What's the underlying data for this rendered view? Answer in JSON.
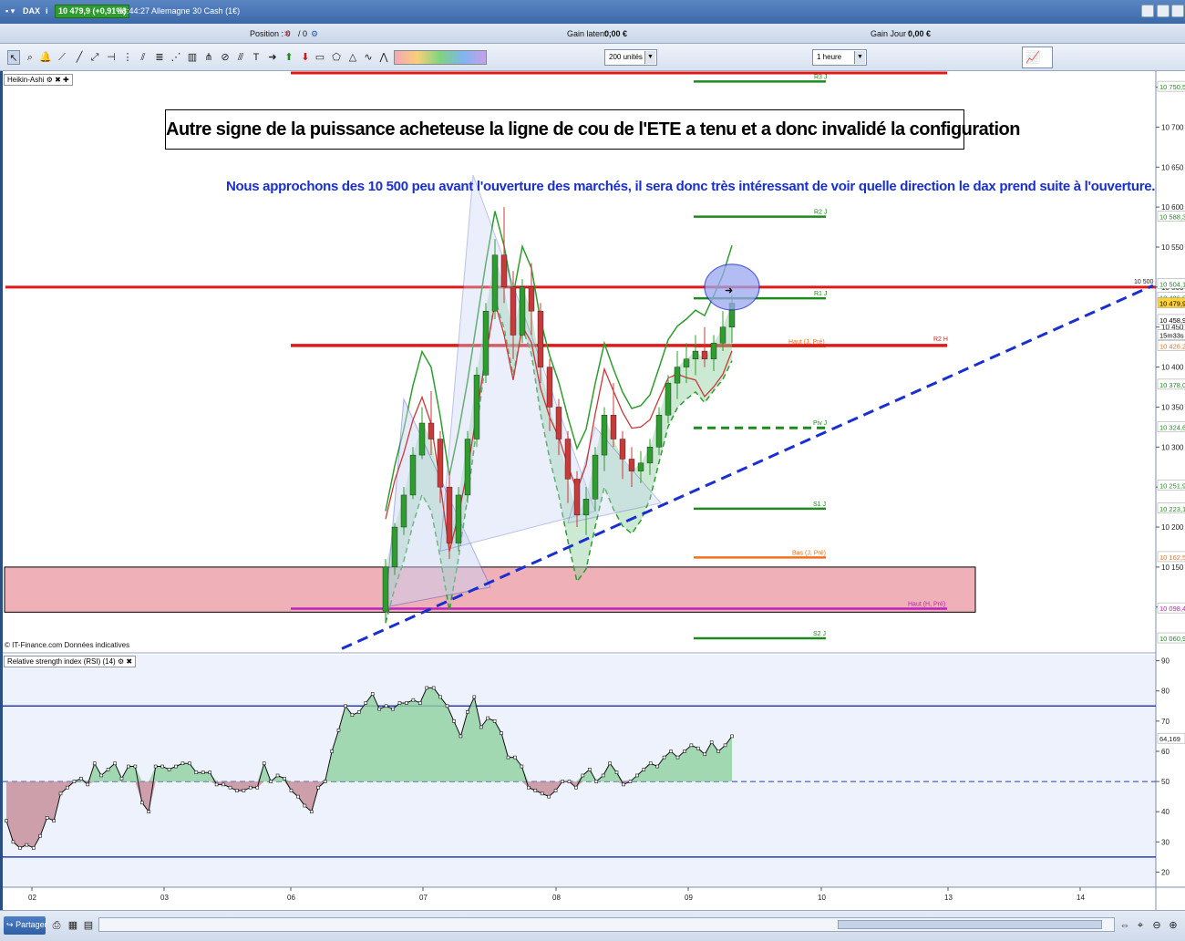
{
  "window": {
    "symbol": "DAX",
    "info_glyph": "i",
    "price_badge": "10 479,9 (+0,91%)",
    "time_name": "08:44:27 Allemagne 30 Cash (1€)"
  },
  "position_bar": {
    "position": "Position : 0",
    "position_mid": "/ 0",
    "gain_latent": "Gain latent :",
    "gain_latent_value": "0,00 €",
    "gain_jour": "Gain Jour :",
    "gain_jour_value": "0,00 €"
  },
  "toolbar": {
    "units_value": "200 unités",
    "timeframe_value": "1 heure"
  },
  "panes": {
    "price_label": "Heikin-Ashi",
    "rsi_label": "Relative strength index (RSI) (14)"
  },
  "annotations": {
    "boxed_title": "Autre signe de la puissance acheteuse la ligne de cou de l'ETE a tenu et a donc invalidé la configuration",
    "blue_text": "Nous approchons des 10 500 peu avant l'ouverture des marchés, il sera donc très intéressant de voir quelle direction le dax prend suite à l'ouverture."
  },
  "credit": "© IT-Finance.com Données indicatives",
  "bottom_bar": {
    "share_label": "Partager"
  },
  "colors": {
    "bull": "#2e9c2e",
    "bear": "#c83a3a",
    "resistance": "#e01818",
    "trendline": "#1a2fd0",
    "pivot_green": "#1e8a1e",
    "orange": "#f07020",
    "magenta": "#c020c0",
    "zone_fill": "#f0b0b8",
    "rsi_line": "#2a3fb0"
  },
  "chart_data": [
    {
      "type": "candlestick",
      "style": "Heikin-Ashi",
      "ylim": [
        10045,
        10770
      ],
      "y_ticks": [
        10100,
        10150,
        10200,
        10250,
        10300,
        10350,
        10400,
        10450,
        10500,
        10550,
        10600,
        10650,
        10700,
        10750
      ],
      "x_tick_labels": [
        "02",
        "03",
        "06",
        "07",
        "08",
        "09",
        "10",
        "13",
        "14"
      ],
      "price_labels": [
        "10 750,5",
        "10 588,3",
        "10 504,1",
        "10 486,8",
        "10 479,9",
        "10 458,9",
        "15m33s",
        "10 426,2",
        "10 378,0",
        "10 324,6",
        "10 251,9",
        "10 223,1",
        "10 162,5",
        "10 098,4",
        "10 060,9"
      ],
      "levels": [
        {
          "name": "R3 J",
          "value": 10757
        },
        {
          "name": "R2 J",
          "value": 10588
        },
        {
          "name": "R1 J",
          "value": 10486
        },
        {
          "name": "Haut (J, Pré)",
          "value": 10426
        },
        {
          "name": "R2 H",
          "value": 10427
        },
        {
          "name": "Piv J",
          "value": 10324
        },
        {
          "name": "S1 J",
          "value": 10223
        },
        {
          "name": "Bas (J, Pré)",
          "value": 10162
        },
        {
          "name": "Haut (H, Pré)",
          "value": 10098
        },
        {
          "name": "S2 J",
          "value": 10061
        }
      ],
      "resistance_label": "10 500",
      "candles_ohlc": [
        [
          10095,
          10160,
          10080,
          10150
        ],
        [
          10150,
          10205,
          10140,
          10200
        ],
        [
          10200,
          10250,
          10190,
          10240
        ],
        [
          10240,
          10300,
          10235,
          10290
        ],
        [
          10290,
          10350,
          10285,
          10330
        ],
        [
          10330,
          10370,
          10290,
          10310
        ],
        [
          10310,
          10320,
          10230,
          10250
        ],
        [
          10250,
          10270,
          10160,
          10180
        ],
        [
          10180,
          10250,
          10170,
          10240
        ],
        [
          10240,
          10320,
          10230,
          10310
        ],
        [
          10310,
          10400,
          10300,
          10390
        ],
        [
          10390,
          10480,
          10380,
          10470
        ],
        [
          10470,
          10560,
          10460,
          10540
        ],
        [
          10540,
          10600,
          10480,
          10500
        ],
        [
          10500,
          10520,
          10410,
          10440
        ],
        [
          10440,
          10510,
          10430,
          10500
        ],
        [
          10500,
          10530,
          10440,
          10470
        ],
        [
          10470,
          10480,
          10380,
          10400
        ],
        [
          10400,
          10410,
          10320,
          10350
        ],
        [
          10350,
          10360,
          10290,
          10310
        ],
        [
          10310,
          10320,
          10230,
          10260
        ],
        [
          10260,
          10270,
          10200,
          10215
        ],
        [
          10215,
          10250,
          10190,
          10235
        ],
        [
          10235,
          10300,
          10220,
          10290
        ],
        [
          10290,
          10350,
          10270,
          10340
        ],
        [
          10340,
          10380,
          10300,
          10310
        ],
        [
          10310,
          10320,
          10260,
          10285
        ],
        [
          10285,
          10300,
          10250,
          10270
        ],
        [
          10270,
          10295,
          10255,
          10280
        ],
        [
          10280,
          10310,
          10265,
          10300
        ],
        [
          10300,
          10350,
          10290,
          10340
        ],
        [
          10340,
          10390,
          10330,
          10380
        ],
        [
          10380,
          10420,
          10360,
          10400
        ],
        [
          10400,
          10430,
          10380,
          10410
        ],
        [
          10410,
          10440,
          10390,
          10420
        ],
        [
          10420,
          10450,
          10400,
          10410
        ],
        [
          10410,
          10440,
          10395,
          10430
        ],
        [
          10430,
          10470,
          10420,
          10450
        ],
        [
          10450,
          10490,
          10430,
          10480
        ]
      ]
    },
    {
      "type": "line",
      "name": "Relative strength index (RSI) (14)",
      "ylim": [
        15,
        92
      ],
      "y_ticks": [
        20,
        30,
        40,
        50,
        60,
        70,
        80,
        90
      ],
      "last_value_label": "64,169",
      "levels": [
        25,
        50,
        75
      ],
      "values": [
        37,
        30,
        28,
        29,
        28,
        32,
        38,
        37,
        46,
        48,
        50,
        51,
        49,
        56,
        52,
        54,
        56,
        51,
        55,
        55,
        43,
        40,
        55,
        55,
        54,
        55,
        56,
        56,
        53,
        53,
        53,
        49,
        49,
        48,
        47,
        47,
        48,
        48,
        56,
        50,
        52,
        51,
        47,
        45,
        42,
        40,
        48,
        50,
        60,
        67,
        75,
        72,
        73,
        76,
        79,
        74,
        75,
        74,
        76,
        76,
        77,
        76,
        81,
        81,
        78,
        75,
        70,
        65,
        73,
        78,
        68,
        71,
        70,
        66,
        58,
        58,
        55,
        48,
        47,
        46,
        45,
        47,
        50,
        50,
        48,
        52,
        54,
        50,
        52,
        56,
        53,
        49,
        50,
        52,
        54,
        56,
        55,
        58,
        60,
        58,
        60,
        62,
        61,
        59,
        63,
        60,
        62,
        65
      ]
    }
  ]
}
